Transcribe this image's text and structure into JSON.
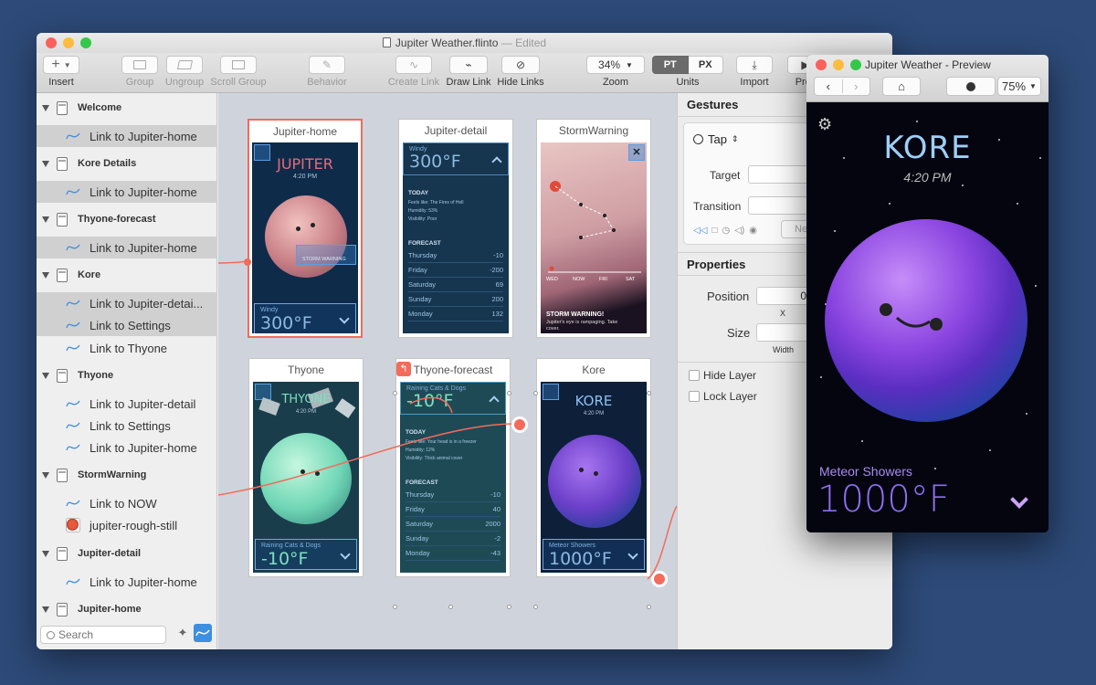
{
  "window": {
    "title": "Jupiter Weather.flinto",
    "edited": "— Edited"
  },
  "toolbar": {
    "insert": "Insert",
    "group": "Group",
    "ungroup": "Ungroup",
    "scroll_group": "Scroll Group",
    "behavior": "Behavior",
    "create_link": "Create Link",
    "draw_link": "Draw Link",
    "hide_links": "Hide Links",
    "zoom_value": "34%",
    "zoom": "Zoom",
    "unit_pt": "PT",
    "unit_px": "PX",
    "units": "Units",
    "import": "Import",
    "preview": "Prev"
  },
  "sidebar": {
    "rows": [
      {
        "type": "group",
        "label": "Welcome"
      },
      {
        "type": "link",
        "label": "Link to Jupiter-home",
        "selected": true
      },
      {
        "type": "group",
        "label": "Kore Details"
      },
      {
        "type": "link",
        "label": "Link to Jupiter-home",
        "selected": true
      },
      {
        "type": "group",
        "label": "Thyone-forecast"
      },
      {
        "type": "link",
        "label": "Link to Jupiter-home",
        "selected": true
      },
      {
        "type": "group",
        "label": "Kore"
      },
      {
        "type": "link",
        "label": "Link to Jupiter-detai...",
        "selected": true
      },
      {
        "type": "link",
        "label": "Link to Settings",
        "selected": true
      },
      {
        "type": "link",
        "label": "Link to Thyone"
      },
      {
        "type": "group",
        "label": "Thyone"
      },
      {
        "type": "link",
        "label": "Link to Jupiter-detail"
      },
      {
        "type": "link",
        "label": "Link to Settings"
      },
      {
        "type": "link",
        "label": "Link to Jupiter-home"
      },
      {
        "type": "group",
        "label": "StormWarning"
      },
      {
        "type": "link",
        "label": "Link to NOW"
      },
      {
        "type": "image",
        "label": "jupiter-rough-still"
      },
      {
        "type": "group",
        "label": "Jupiter-detail"
      },
      {
        "type": "link",
        "label": "Link to Jupiter-home"
      },
      {
        "type": "group",
        "label": "Jupiter-home"
      }
    ],
    "search_placeholder": "Search"
  },
  "artboards": {
    "jupiter_home": {
      "title": "Jupiter-home",
      "planet": "JUPITER",
      "time": "4:20 PM",
      "tag": "STORM WARNING",
      "cond": "Windy",
      "temp": "300°F"
    },
    "jupiter_detail": {
      "title": "Jupiter-detail",
      "cond": "Windy",
      "temp": "300°F",
      "today": "TODAY",
      "details": [
        "Feels like:    The Fires of Hell",
        "Humidity:       53%",
        "Visibility:       Poor"
      ],
      "forecast": "FORECAST",
      "rows": [
        {
          "day": "Thursday",
          "val": "-10"
        },
        {
          "day": "Friday",
          "val": "-200"
        },
        {
          "day": "Saturday",
          "val": "69"
        },
        {
          "day": "Sunday",
          "val": "200"
        },
        {
          "day": "Monday",
          "val": "132"
        }
      ]
    },
    "storm": {
      "title": "StormWarning",
      "days": [
        "WED",
        "NOW",
        "FRI",
        "SAT"
      ],
      "warn_title": "STORM WARNING!",
      "warn_body": "Jupiter's eye is rampaging. Take cover."
    },
    "thyone": {
      "title": "Thyone",
      "planet": "THYONE",
      "time": "4:20 PM",
      "cond": "Raining Cats & Dogs",
      "temp": "-10°F"
    },
    "thyone_forecast": {
      "title": "Thyone-forecast",
      "cond": "Raining Cats & Dogs",
      "temp": "-10°F",
      "today": "TODAY",
      "details": [
        "Feels like:    Your head is in a freezer",
        "Humidity:       12%",
        "Visibility:       Thick animal cover"
      ],
      "forecast": "FORECAST",
      "rows": [
        {
          "day": "Thursday",
          "val": "-10"
        },
        {
          "day": "Friday",
          "val": "40"
        },
        {
          "day": "Saturday",
          "val": "2000"
        },
        {
          "day": "Sunday",
          "val": "-2"
        },
        {
          "day": "Monday",
          "val": "-43"
        }
      ]
    },
    "kore": {
      "title": "Kore",
      "planet": "KORE",
      "time": "4:20 PM",
      "cond": "Meteor Showers",
      "temp": "1000°F"
    }
  },
  "inspector": {
    "gestures": "Gestures",
    "gesture_value": "Tap",
    "target": "Target",
    "transition": "Transition",
    "new_btn": "Ne",
    "properties": "Properties",
    "position": "Position",
    "pos_value": "0",
    "x_label": "X",
    "size": "Size",
    "width_label": "Width",
    "hide_layer": "Hide Layer",
    "lock_layer": "Lock Layer"
  },
  "preview": {
    "title": "Jupiter Weather - Preview",
    "zoom": "75%",
    "planet": "KORE",
    "time": "4:20 PM",
    "cond": "Meteor Showers",
    "temp": "1000°F"
  },
  "colors": {
    "link": "#f26b5b",
    "blue": "#3d8fe0",
    "screen": "#0f2b4a"
  }
}
